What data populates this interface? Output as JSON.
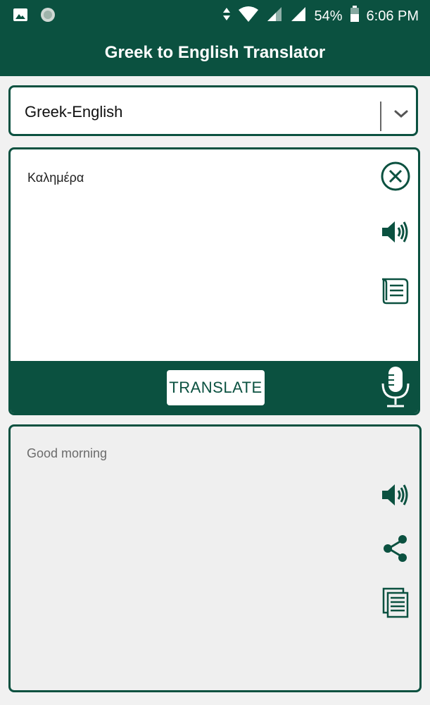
{
  "status_bar": {
    "battery": "54%",
    "time": "6:06 PM"
  },
  "app_bar": {
    "title": "Greek to English Translator"
  },
  "language_selector": {
    "selected": "Greek-English"
  },
  "input": {
    "text": "Καλημέρα",
    "translate_label": "TRANSLATE"
  },
  "output": {
    "text": "Good morning"
  },
  "colors": {
    "primary": "#0b5140",
    "background": "#f1f1f1",
    "card_output": "#efefef"
  },
  "icons": {
    "input": [
      "close-circle-icon",
      "speaker-icon",
      "scroll-icon",
      "microphone-icon"
    ],
    "output": [
      "speaker-icon",
      "share-icon",
      "copy-icon"
    ],
    "status": [
      "image-icon",
      "globe-icon",
      "data-arrows-icon",
      "wifi-icon",
      "signal-icon",
      "signal-icon",
      "battery-icon"
    ]
  }
}
